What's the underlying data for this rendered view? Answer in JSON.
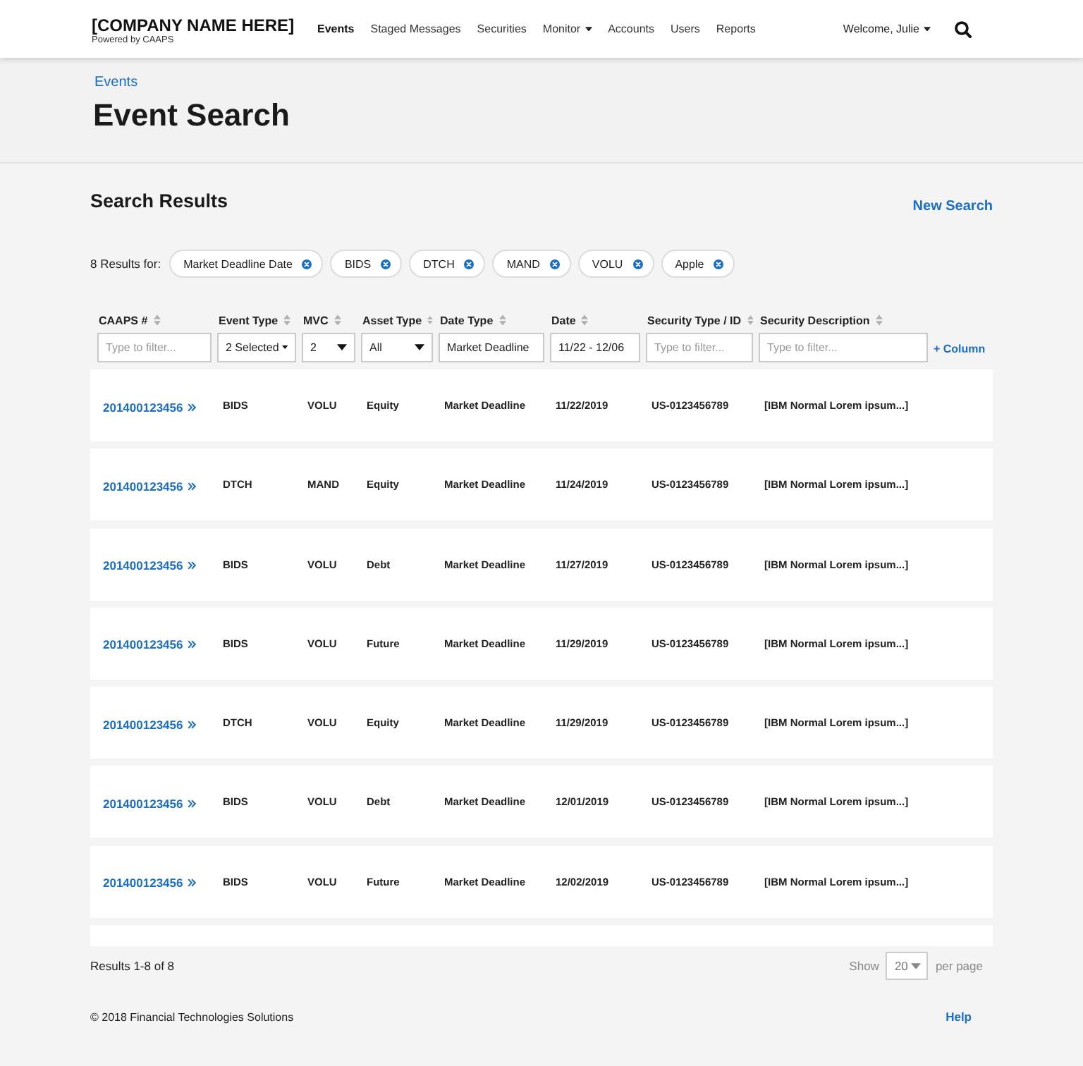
{
  "header": {
    "logo": "[COMPANY NAME HERE]",
    "tagline": "Powered by CAAPS",
    "nav": [
      {
        "label": "Events",
        "selected": true,
        "dropdown": false
      },
      {
        "label": "Staged Messages",
        "selected": false,
        "dropdown": false
      },
      {
        "label": "Securities",
        "selected": false,
        "dropdown": false
      },
      {
        "label": "Monitor",
        "selected": false,
        "dropdown": true
      },
      {
        "label": "Accounts",
        "selected": false,
        "dropdown": false
      },
      {
        "label": "Users",
        "selected": false,
        "dropdown": false
      },
      {
        "label": "Reports",
        "selected": false,
        "dropdown": false
      }
    ],
    "user_menu": "Welcome, Julie"
  },
  "breadcrumb": "Events",
  "title": "Event Search",
  "results": {
    "heading": "Search Results",
    "new_search": "New Search",
    "count_label": "8 Results for:",
    "chips": [
      "Market Deadline Date",
      "BIDS",
      "DTCH",
      "MAND",
      "VOLU",
      "Apple"
    ],
    "columns": [
      {
        "label": "CAAPS #",
        "filter": {
          "kind": "text",
          "placeholder": "Type to filter..."
        }
      },
      {
        "label": "Event Type",
        "filter": {
          "kind": "select",
          "value": "2 Selected"
        }
      },
      {
        "label": "MVC",
        "filter": {
          "kind": "select",
          "value": "2"
        }
      },
      {
        "label": "Asset Type",
        "filter": {
          "kind": "select",
          "value": "All"
        }
      },
      {
        "label": "Date Type",
        "filter": {
          "kind": "text",
          "value": "Market Deadline"
        }
      },
      {
        "label": "Date",
        "filter": {
          "kind": "text",
          "value": "11/22 - 12/06"
        }
      },
      {
        "label": "Security Type / ID",
        "filter": {
          "kind": "text",
          "placeholder": "Type to filter..."
        }
      },
      {
        "label": "Security Description",
        "filter": {
          "kind": "text",
          "placeholder": "Type to filter..."
        }
      }
    ],
    "add_column": "+ Column",
    "rows": [
      {
        "cells": [
          "201400123456",
          "BIDS",
          "VOLU",
          "Equity",
          "Market Deadline",
          "11/22/2019",
          "US-0123456789",
          "[IBM Normal Lorem ipsum...]"
        ]
      },
      {
        "cells": [
          "201400123456",
          "DTCH",
          "MAND",
          "Equity",
          "Market Deadline",
          "11/24/2019",
          "US-0123456789",
          "[IBM Normal Lorem ipsum...]"
        ]
      },
      {
        "cells": [
          "201400123456",
          "BIDS",
          "VOLU",
          "Debt",
          "Market Deadline",
          "11/27/2019",
          "US-0123456789",
          "[IBM Normal Lorem ipsum...]"
        ]
      },
      {
        "cells": [
          "201400123456",
          "BIDS",
          "VOLU",
          "Future",
          "Market Deadline",
          "11/29/2019",
          "US-0123456789",
          "[IBM Normal Lorem ipsum...]"
        ]
      },
      {
        "cells": [
          "201400123456",
          "DTCH",
          "VOLU",
          "Equity",
          "Market Deadline",
          "11/29/2019",
          "US-0123456789",
          "[IBM Normal Lorem ipsum...]"
        ]
      },
      {
        "cells": [
          "201400123456",
          "BIDS",
          "VOLU",
          "Debt",
          "Market Deadline",
          "12/01/2019",
          "US-0123456789",
          "[IBM Normal Lorem ipsum...]"
        ]
      },
      {
        "cells": [
          "201400123456",
          "BIDS",
          "VOLU",
          "Future",
          "Market Deadline",
          "12/02/2019",
          "US-0123456789",
          "[IBM Normal Lorem ipsum...]"
        ]
      }
    ]
  },
  "pagination": {
    "summary": "Results 1-8 of 8",
    "show_label": "Show",
    "page_size": "20",
    "per_page_label": "per page"
  },
  "footer": {
    "copyright": "© 2018 Financial Technologies Solutions",
    "help": "Help"
  }
}
